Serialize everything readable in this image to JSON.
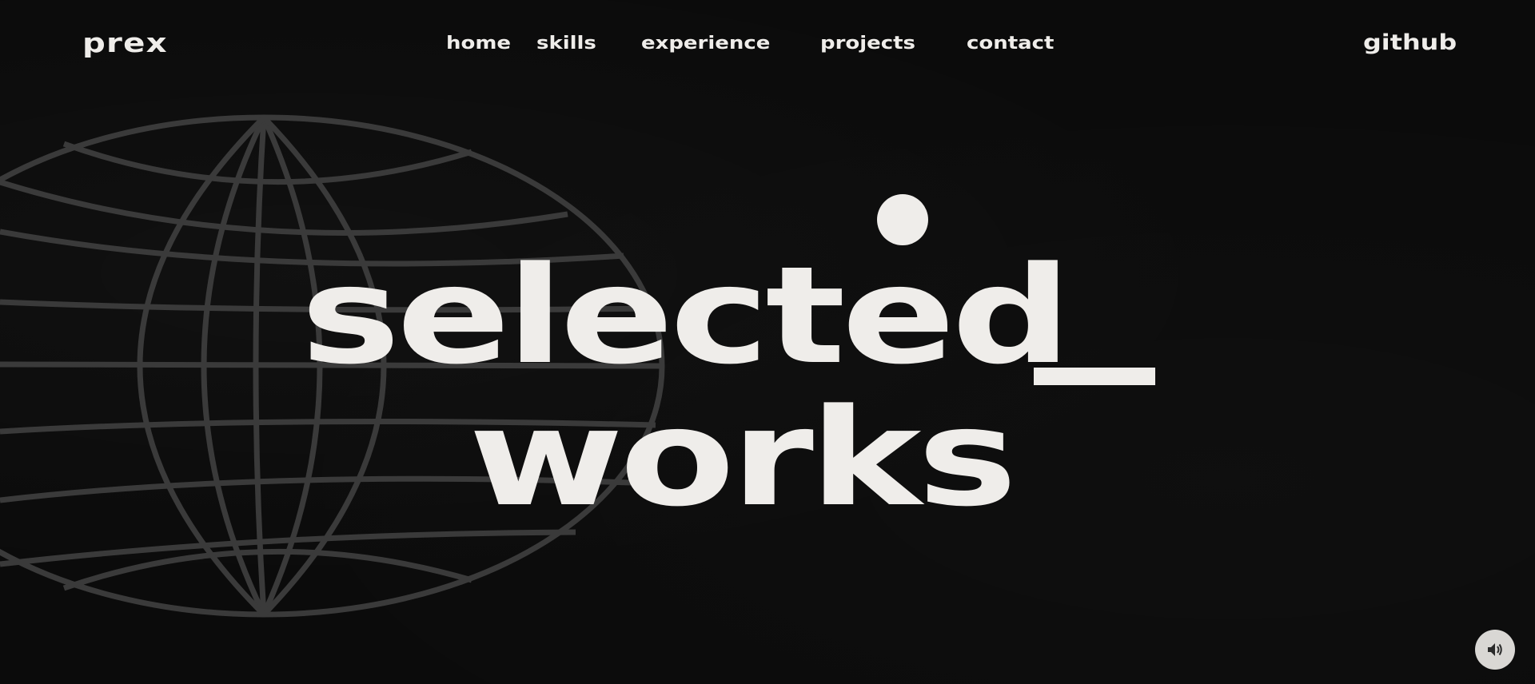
{
  "header": {
    "logo": "prex",
    "nav": [
      {
        "label": "home"
      },
      {
        "label": "skills"
      },
      {
        "label": "experience"
      },
      {
        "label": "projects"
      },
      {
        "label": "contact"
      }
    ],
    "external_link": "github"
  },
  "hero": {
    "line1": "selected",
    "line2": "works"
  },
  "controls": {
    "sound_icon": "speaker-volume-icon"
  },
  "colors": {
    "background": "#0b0b0b",
    "foreground": "#efedea",
    "globe_lines": "#3a3a3a",
    "sound_button": "#d9d7d4"
  }
}
